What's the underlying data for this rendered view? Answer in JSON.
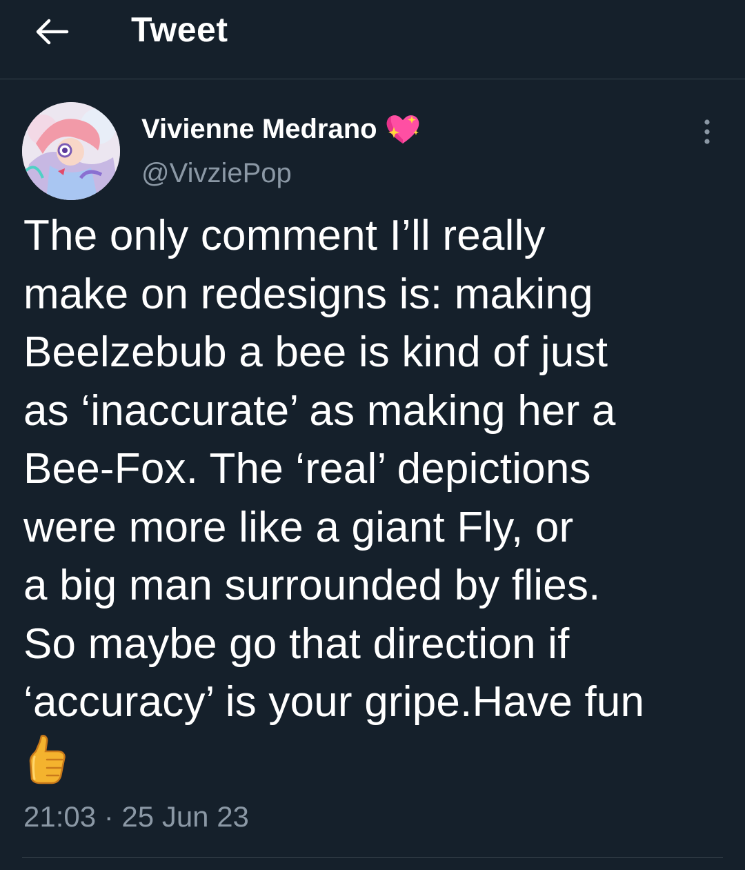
{
  "header": {
    "back_icon": "arrow-left-icon",
    "title": "Tweet"
  },
  "tweet": {
    "author": {
      "display_name": "Vivienne Medrano",
      "handle": "@VivziePop",
      "badge_icon": "sparkling-heart-icon"
    },
    "text": "The only comment I’ll really\nmake on redesigns is: making\nBeelzebub a bee is kind of just\nas ‘inaccurate’ as making her a\nBee-Fox. The ‘real’ depictions\nwere more like a giant Fly, or\na big man surrounded by flies.\nSo maybe go that direction if\n‘accuracy’ is your gripe.Have fun",
    "trailing_emoji": "thumbs-up-icon",
    "timestamp": "21:03 · 25 Jun 23",
    "more_icon": "more-vertical-icon"
  },
  "colors": {
    "background": "#15202b",
    "secondary_text": "#8b98a5",
    "divider": "#38444d"
  }
}
